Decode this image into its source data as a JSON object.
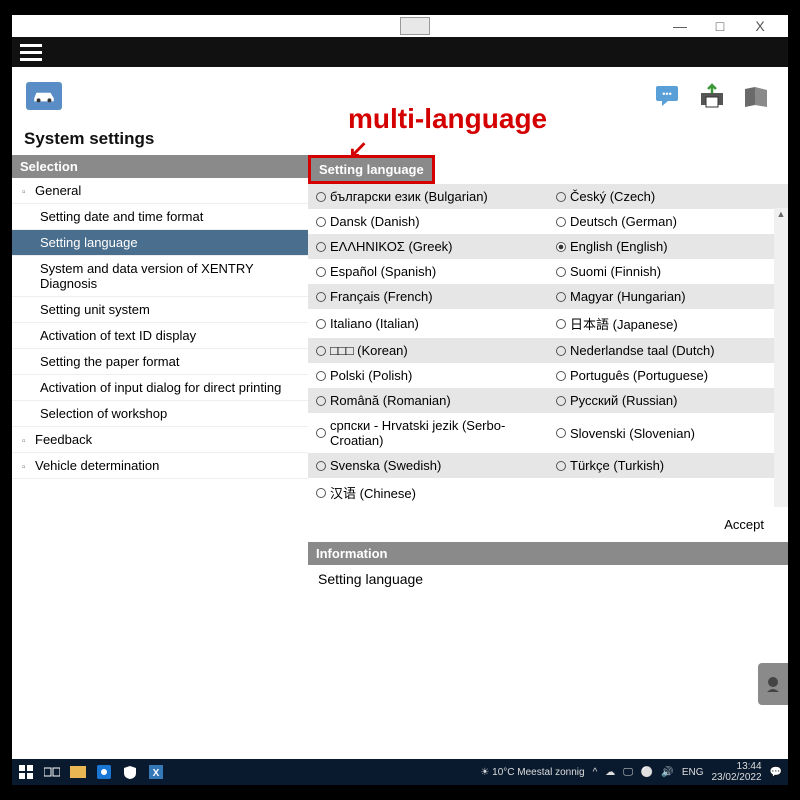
{
  "window": {
    "minimize": "—",
    "maximize": "□",
    "close": "X"
  },
  "page_title": "System settings",
  "annotation": {
    "label": "multi-language",
    "arrow": "↙"
  },
  "sidebar": {
    "header": "Selection",
    "nodes": [
      {
        "label": "General",
        "expandable": true,
        "children": [
          {
            "label": "Setting date and time format"
          },
          {
            "label": "Setting language",
            "selected": true
          },
          {
            "label": "System and data version of XENTRY Diagnosis"
          },
          {
            "label": "Setting unit system"
          },
          {
            "label": "Activation of text ID display"
          },
          {
            "label": "Setting the paper format"
          },
          {
            "label": "Activation of input dialog for direct printing"
          },
          {
            "label": "Selection of workshop"
          }
        ]
      },
      {
        "label": "Feedback",
        "expandable": true
      },
      {
        "label": "Vehicle determination",
        "expandable": true
      }
    ]
  },
  "main": {
    "header": "Setting language",
    "languages": [
      {
        "left": "български език (Bulgarian)",
        "right": "Český (Czech)"
      },
      {
        "left": "Dansk (Danish)",
        "right": "Deutsch (German)"
      },
      {
        "left": "ΕΛΛΗΝΙΚΟΣ (Greek)",
        "right": "English (English)",
        "right_selected": true
      },
      {
        "left": "Español (Spanish)",
        "right": "Suomi (Finnish)"
      },
      {
        "left": "Français (French)",
        "right": "Magyar (Hungarian)"
      },
      {
        "left": "Italiano (Italian)",
        "right": "日本語 (Japanese)"
      },
      {
        "left": "□□□ (Korean)",
        "right": "Nederlandse taal (Dutch)"
      },
      {
        "left": "Polski (Polish)",
        "right": "Português (Portuguese)"
      },
      {
        "left": "Română (Romanian)",
        "right": "Русский (Russian)"
      },
      {
        "left": "српски - Hrvatski jezik (Serbo-Croatian)",
        "right": "Slovenski (Slovenian)"
      },
      {
        "left": "Svenska (Swedish)",
        "right": "Türkçe (Turkish)"
      },
      {
        "left": "汉语 (Chinese)",
        "right": ""
      }
    ],
    "accept": "Accept",
    "info_header": "Information",
    "info_text": "Setting language"
  },
  "taskbar": {
    "weather": "10°C  Meestal zonnig",
    "lang": "ENG",
    "clock": {
      "time": "13:44",
      "date": "23/02/2022"
    }
  }
}
